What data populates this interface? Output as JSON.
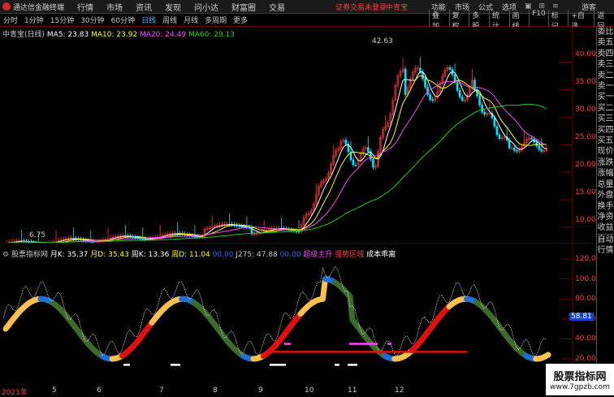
{
  "topbar": {
    "app_title": "通达信金融终端",
    "menu": [
      "行情",
      "市场",
      "资讯",
      "发现",
      "问小达",
      "财富圈",
      "交易"
    ],
    "login_notice": "证券交易未登录",
    "stock_name": "中青宝",
    "right_menu": [
      "功能",
      "市场",
      "公式",
      "选项"
    ],
    "guest": "游客"
  },
  "periods": [
    {
      "label": "分时",
      "active": false
    },
    {
      "label": "1分钟",
      "active": false
    },
    {
      "label": "15分钟",
      "active": false
    },
    {
      "label": "30分钟",
      "active": false
    },
    {
      "label": "60分钟",
      "active": false
    },
    {
      "label": "日线",
      "active": true
    },
    {
      "label": "周线",
      "active": false
    },
    {
      "label": "月线",
      "active": false
    },
    {
      "label": "多周期",
      "active": false
    },
    {
      "label": "更多",
      "active": false
    }
  ],
  "tools": [
    "叠加",
    "复权",
    "多股",
    "统计",
    "画线",
    "F10",
    "标记",
    "+自选",
    "返回"
  ],
  "main_legend": {
    "title": "中青宝(日线)",
    "ma5": "MA5: 23.83",
    "ma10": "MA10: 23.92",
    "ma20": "MA20: 24.49",
    "ma60": "MA60: 29.13",
    "high_label": "42.63",
    "low_label": "6.75"
  },
  "price_axis": [
    "40.00",
    "35.00",
    "30.00",
    "25.00",
    "20.00",
    "15.00",
    "10.00"
  ],
  "ind_legend": {
    "name": "股票指标网",
    "k": "月K: 35.37",
    "d": "月D: 35.43",
    "wk": "周K: 13.36",
    "wd": "周D: 11.04",
    "v1": "00.00",
    "j": "J275: 47.88",
    "v2": "00.00",
    "t1": "超级主升",
    "t2": "强势区域",
    "t3": "成本乖离"
  },
  "ind_axis": [
    "120.0",
    "100.0",
    "80.00",
    "60.00",
    "40.00",
    "20.00"
  ],
  "ind_value_box": "58.81",
  "x_axis": {
    "year": "2021年",
    "months": [
      "5",
      "6",
      "7",
      "8",
      "9",
      "10",
      "11",
      "12"
    ]
  },
  "right_panel": {
    "top": [
      "委比",
      "卖五",
      "卖四",
      "卖三",
      "卖二",
      "卖一",
      "买一",
      "买二",
      "买三",
      "买四",
      "买五",
      "现价",
      "涨跌",
      "涨幅",
      "总量",
      "外盘",
      "换手",
      "净资",
      "收益"
    ],
    "bottom": [
      "自动",
      "行情"
    ]
  },
  "watermark": {
    "line1": "股票指标网",
    "line2": "www.7gpzb.com"
  },
  "colors": {
    "up": "#ff3333",
    "down": "#00e5ff",
    "ma5": "#ffffff",
    "ma10": "#ffff00",
    "ma20": "#ff44ff",
    "ma60": "#22cc22"
  }
}
